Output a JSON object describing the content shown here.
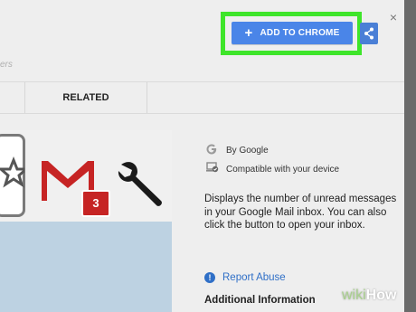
{
  "header": {
    "add_button_label": "ADD TO CHROME",
    "add_button_plus": "+",
    "subtext": "ers",
    "close_glyph": "×"
  },
  "tabs": [
    {
      "label": "RELATED"
    }
  ],
  "preview": {
    "badge_count": "3",
    "icons": [
      "star-icon",
      "gmail-icon",
      "wrench-icon"
    ]
  },
  "side": {
    "author": "By Google",
    "compat": "Compatible with your device",
    "description": "Displays the number of unread messages in your Google Mail inbox. You can also click the button to open your inbox.",
    "report_abuse": "Report Abuse",
    "report_icon_glyph": "!",
    "additional_info": "Additional Information"
  },
  "watermark": {
    "part1": "wiki",
    "part2": "How"
  },
  "colors": {
    "highlight": "#3ee52a",
    "button_blue": "#4a85e8",
    "link_blue": "#2f6fc7",
    "gmail_red": "#c62424"
  }
}
